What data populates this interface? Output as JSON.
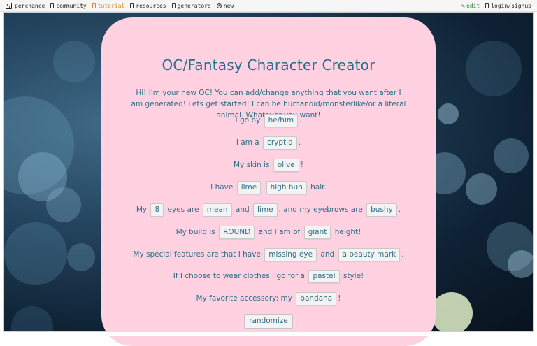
{
  "nav": {
    "left": [
      {
        "label": "perchance",
        "icon": "dice-icon"
      },
      {
        "label": "community",
        "icon": "chat-icon"
      },
      {
        "label": "tutorial",
        "icon": "book-icon"
      },
      {
        "label": "resources",
        "icon": "folder-icon"
      },
      {
        "label": "generators",
        "icon": "grid-icon"
      },
      {
        "label": "new",
        "icon": "plus-icon"
      }
    ],
    "right": [
      {
        "label": "edit",
        "icon": "pencil-icon"
      },
      {
        "label": "login/signup",
        "icon": "user-icon"
      }
    ]
  },
  "generator": {
    "title": "OC/Fantasy Character Creator",
    "intro": "Hi! I'm your new OC! You can add/change anything that you want after I am generated! Lets get started! I can be humanoid/monsterlike/or a literal animal. Whatever you want!",
    "pronouns_prefix": "I go by",
    "pronouns": "he/him",
    "pronouns_suffix": ".",
    "species_prefix": "I am a",
    "species": "cryptid",
    "species_suffix": ".",
    "skin_prefix": "My skin is",
    "skin": "olive",
    "skin_suffix": "!",
    "hair_prefix": "I have",
    "hair_color": "lime",
    "hair_style": "high bun",
    "hair_suffix": "hair.",
    "eyes_prefix": "My",
    "eye_count": "8",
    "eyes_mid1": "eyes are",
    "eye_type": "mean",
    "eyes_and": "and",
    "eye_color": "lime",
    "eyes_mid2": ", and my eyebrows are",
    "eyebrows": "bushy",
    "eyes_suffix": ".",
    "build_prefix": "My build is",
    "build": "ROUND",
    "build_mid": "and I am of",
    "height": "giant",
    "build_suffix": "height!",
    "features_prefix": "My special features are that I have",
    "feature1": "missing eye",
    "features_and": "and",
    "feature2": "a beauty mark",
    "features_suffix": ".",
    "clothes_prefix": "If I choose to wear clothes I go for a",
    "clothes": "pastel",
    "clothes_suffix": "style!",
    "accessory_prefix": "My favorite accessory: my",
    "accessory": "bandana",
    "accessory_suffix": "!",
    "randomize_label": "randomize"
  },
  "colors": {
    "card_bg": "#ffd1e1",
    "text": "#2e6f87",
    "title": "#25708a",
    "tutorial": "#e08a18",
    "edit": "#2a8a2a"
  }
}
